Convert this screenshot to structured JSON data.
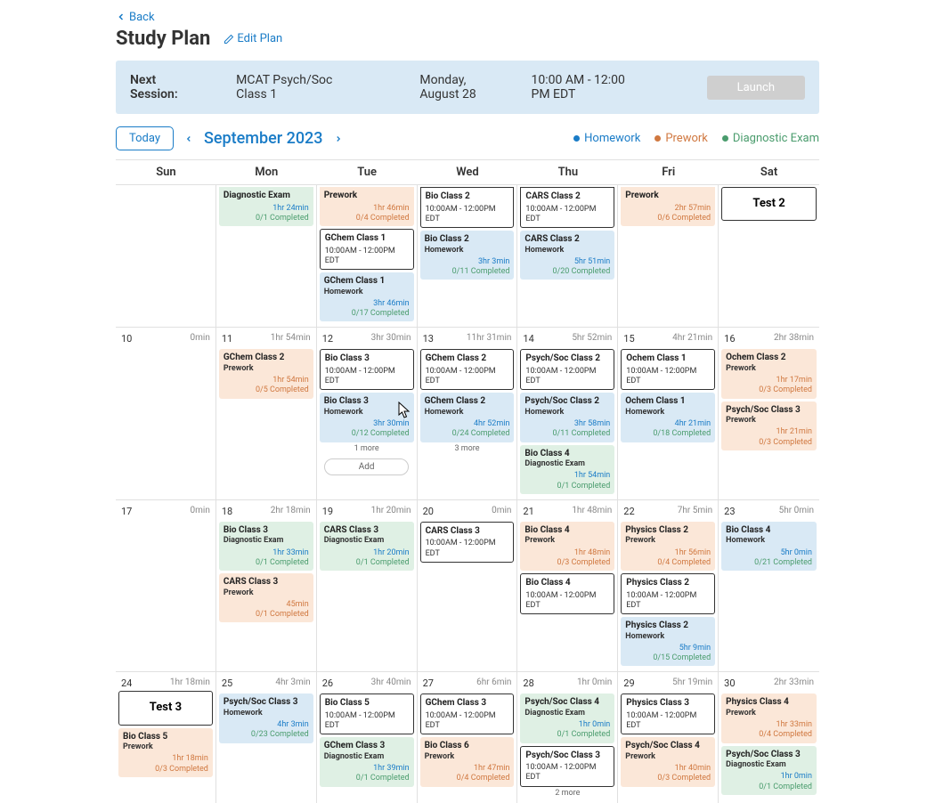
{
  "back_label": "Back",
  "page_title": "Study Plan",
  "edit_label": "Edit Plan",
  "next_session": {
    "label": "Next Session:",
    "class": "MCAT Psych/Soc Class 1",
    "date": "Monday, August 28",
    "time": "10:00 AM - 12:00 PM EDT",
    "launch": "Launch"
  },
  "nav": {
    "today": "Today",
    "month": "September 2023"
  },
  "legend": {
    "homework": "Homework",
    "prework": "Prework",
    "diagnostic": "Diagnostic Exam"
  },
  "weekdays": [
    "Sun",
    "Mon",
    "Tue",
    "Wed",
    "Thu",
    "Fri",
    "Sat"
  ],
  "weeks": [
    {
      "cells": [
        {
          "num": "",
          "dur": "",
          "events": []
        },
        {
          "num": "",
          "dur": "",
          "events": [
            {
              "type": "diag",
              "title": "Diagnostic Exam",
              "dur": "1hr 24min",
              "comp": "0/1 Completed",
              "partial": true
            }
          ]
        },
        {
          "num": "",
          "dur": "",
          "events": [
            {
              "type": "pre",
              "title": "Prework",
              "dur": "1hr 46min",
              "comp": "0/4 Completed",
              "partial": true
            },
            {
              "type": "class",
              "title": "GChem Class 1",
              "time": "10:00AM - 12:00PM EDT"
            },
            {
              "type": "hw",
              "title": "GChem Class 1",
              "sub": "Homework",
              "dur": "3hr 46min",
              "comp": "0/17 Completed"
            }
          ]
        },
        {
          "num": "",
          "dur": "",
          "events": [
            {
              "type": "class",
              "title": "Bio Class 2",
              "time": "10:00AM - 12:00PM EDT",
              "partial": true
            },
            {
              "type": "hw",
              "title": "Bio Class 2",
              "sub": "Homework",
              "dur": "3hr 3min",
              "comp": "0/11 Completed"
            }
          ]
        },
        {
          "num": "",
          "dur": "",
          "events": [
            {
              "type": "class",
              "title": "CARS Class 2",
              "time": "10:00AM - 12:00PM EDT",
              "partial": true
            },
            {
              "type": "hw",
              "title": "CARS Class 2",
              "sub": "Homework",
              "dur": "5hr 51min",
              "comp": "0/20 Completed"
            }
          ]
        },
        {
          "num": "",
          "dur": "",
          "events": [
            {
              "type": "pre",
              "title": "Prework",
              "dur": "2hr 57min",
              "comp": "0/6 Completed",
              "partial": true
            }
          ]
        },
        {
          "num": "",
          "dur": "",
          "events": [
            {
              "type": "test",
              "title": "Test 2"
            }
          ]
        }
      ]
    },
    {
      "cells": [
        {
          "num": "10",
          "dur": "0min",
          "events": []
        },
        {
          "num": "11",
          "dur": "1hr 54min",
          "events": [
            {
              "type": "pre",
              "title": "GChem Class 2",
              "sub": "Prework",
              "dur": "1hr 54min",
              "comp": "0/5 Completed"
            }
          ]
        },
        {
          "num": "12",
          "dur": "3hr 30min",
          "events": [
            {
              "type": "class",
              "title": "Bio Class 3",
              "time": "10:00AM - 12:00PM EDT"
            },
            {
              "type": "hw",
              "title": "Bio Class 3",
              "sub": "Homework",
              "dur": "3hr 30min",
              "comp": "0/12 Completed"
            }
          ],
          "more": "1 more",
          "add": "Add"
        },
        {
          "num": "13",
          "dur": "11hr 31min",
          "events": [
            {
              "type": "class",
              "title": "GChem Class 2",
              "time": "10:00AM - 12:00PM EDT"
            },
            {
              "type": "hw",
              "title": "GChem Class 2",
              "sub": "Homework",
              "dur": "4hr 52min",
              "comp": "0/24 Completed"
            }
          ],
          "more": "3 more"
        },
        {
          "num": "14",
          "dur": "5hr 52min",
          "events": [
            {
              "type": "class",
              "title": "Psych/Soc Class 2",
              "time": "10:00AM - 12:00PM EDT"
            },
            {
              "type": "hw",
              "title": "Psych/Soc Class 2",
              "sub": "Homework",
              "dur": "3hr 58min",
              "comp": "0/11 Completed"
            },
            {
              "type": "diag",
              "title": "Bio Class 4",
              "sub": "Diagnostic Exam",
              "dur": "1hr 54min",
              "comp": "0/1 Completed"
            }
          ]
        },
        {
          "num": "15",
          "dur": "4hr 21min",
          "events": [
            {
              "type": "class",
              "title": "Ochem Class 1",
              "time": "10:00AM - 12:00PM EDT"
            },
            {
              "type": "hw",
              "title": "Ochem Class 1",
              "sub": "Homework",
              "dur": "4hr 21min",
              "comp": "0/18 Completed"
            }
          ]
        },
        {
          "num": "16",
          "dur": "2hr 38min",
          "events": [
            {
              "type": "pre",
              "title": "Ochem Class 2",
              "sub": "Prework",
              "dur": "1hr 17min",
              "comp": "0/3 Completed"
            },
            {
              "type": "pre",
              "title": "Psych/Soc Class 3",
              "sub": "Prework",
              "dur": "1hr 21min",
              "comp": "0/3 Completed"
            }
          ]
        }
      ]
    },
    {
      "cells": [
        {
          "num": "17",
          "dur": "0min",
          "events": []
        },
        {
          "num": "18",
          "dur": "2hr 18min",
          "events": [
            {
              "type": "diag",
              "title": "Bio Class 3",
              "sub": "Diagnostic Exam",
              "dur": "1hr 33min",
              "comp": "0/1 Completed"
            },
            {
              "type": "pre",
              "title": "CARS Class 3",
              "sub": "Prework",
              "dur": "45min",
              "comp": "0/1 Completed"
            }
          ]
        },
        {
          "num": "19",
          "dur": "1hr 20min",
          "events": [
            {
              "type": "diag",
              "title": "CARS Class 3",
              "sub": "Diagnostic Exam",
              "dur": "1hr 20min",
              "comp": "0/1 Completed"
            }
          ]
        },
        {
          "num": "20",
          "dur": "0min",
          "events": [
            {
              "type": "class",
              "title": "CARS Class 3",
              "time": "10:00AM - 12:00PM EDT"
            }
          ]
        },
        {
          "num": "21",
          "dur": "1hr 48min",
          "events": [
            {
              "type": "pre",
              "title": "Bio Class 4",
              "sub": "Prework",
              "dur": "1hr 48min",
              "comp": "0/3 Completed"
            },
            {
              "type": "class",
              "title": "Bio Class 4",
              "time": "10:00AM - 12:00PM EDT"
            }
          ]
        },
        {
          "num": "22",
          "dur": "7hr 5min",
          "events": [
            {
              "type": "pre",
              "title": "Physics Class 2",
              "sub": "Prework",
              "dur": "1hr 56min",
              "comp": "0/4 Completed"
            },
            {
              "type": "class",
              "title": "Physics Class 2",
              "time": "10:00AM - 12:00PM EDT"
            },
            {
              "type": "hw",
              "title": "Physics Class 2",
              "sub": "Homework",
              "dur": "5hr 9min",
              "comp": "0/15 Completed"
            }
          ]
        },
        {
          "num": "23",
          "dur": "5hr 0min",
          "events": [
            {
              "type": "hw",
              "title": "Bio Class 4",
              "sub": "Homework",
              "dur": "5hr 0min",
              "comp": "0/21 Completed"
            }
          ]
        }
      ]
    },
    {
      "cells": [
        {
          "num": "24",
          "dur": "1hr 18min",
          "events": [
            {
              "type": "test",
              "title": "Test 3"
            },
            {
              "type": "pre",
              "title": "Bio Class 5",
              "sub": "Prework",
              "dur": "1hr 18min",
              "comp": "0/3 Completed"
            }
          ]
        },
        {
          "num": "25",
          "dur": "4hr 3min",
          "events": [
            {
              "type": "hw",
              "title": "Psych/Soc Class 3",
              "sub": "Homework",
              "dur": "4hr 3min",
              "comp": "0/23 Completed"
            }
          ]
        },
        {
          "num": "26",
          "dur": "3hr 40min",
          "events": [
            {
              "type": "class",
              "title": "Bio Class 5",
              "time": "10:00AM - 12:00PM EDT"
            },
            {
              "type": "diag",
              "title": "GChem Class 3",
              "sub": "Diagnostic Exam",
              "dur": "1hr 39min",
              "comp": "0/1 Completed"
            }
          ]
        },
        {
          "num": "27",
          "dur": "6hr 6min",
          "events": [
            {
              "type": "class",
              "title": "GChem Class 3",
              "time": "10:00AM - 12:00PM EDT"
            },
            {
              "type": "pre",
              "title": "Bio Class 6",
              "sub": "Prework",
              "dur": "1hr 47min",
              "comp": "0/4 Completed"
            }
          ]
        },
        {
          "num": "28",
          "dur": "1hr 0min",
          "events": [
            {
              "type": "diag",
              "title": "Psych/Soc Class 4",
              "sub": "Diagnostic Exam",
              "dur": "1hr 0min",
              "comp": "0/1 Completed"
            },
            {
              "type": "class",
              "title": "Psych/Soc Class 3",
              "time": "10:00AM - 12:00PM EDT"
            }
          ],
          "more": "2 more"
        },
        {
          "num": "29",
          "dur": "5hr 19min",
          "events": [
            {
              "type": "class",
              "title": "Physics Class 3",
              "time": "10:00AM - 12:00PM EDT"
            },
            {
              "type": "pre",
              "title": "Psych/Soc Class 4",
              "sub": "Prework",
              "dur": "1hr 40min",
              "comp": "0/3 Completed"
            }
          ]
        },
        {
          "num": "30",
          "dur": "2hr 33min",
          "events": [
            {
              "type": "pre",
              "title": "Physics Class 4",
              "sub": "Prework",
              "dur": "1hr 33min",
              "comp": "0/4 Completed"
            },
            {
              "type": "diag",
              "title": "Psych/Soc Class 3",
              "sub": "Diagnostic Exam",
              "dur": "1hr 0min",
              "comp": "0/1 Completed"
            }
          ]
        }
      ]
    }
  ]
}
